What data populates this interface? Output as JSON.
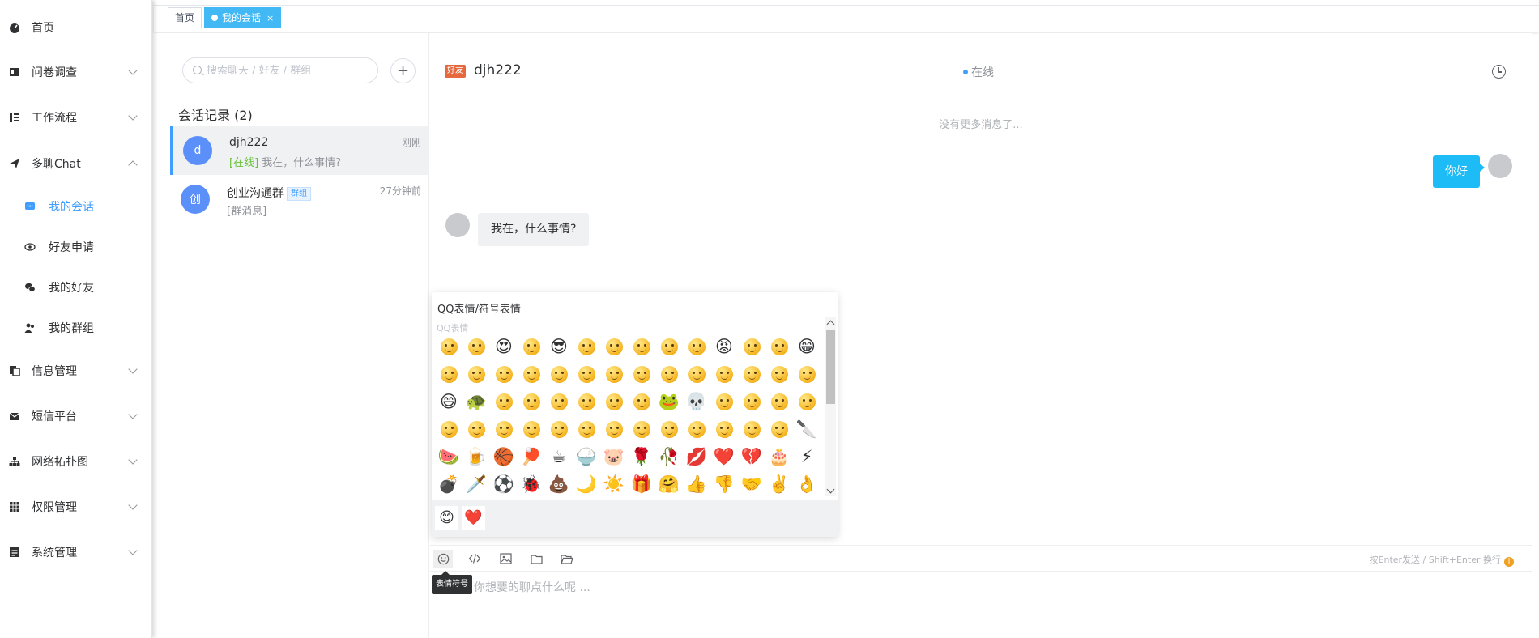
{
  "sidebar": {
    "items": [
      {
        "label": "首页",
        "icon": "dashboard-icon",
        "expandable": false
      },
      {
        "label": "问卷调查",
        "icon": "form-icon",
        "expandable": true
      },
      {
        "label": "工作流程",
        "icon": "list-icon",
        "expandable": true
      },
      {
        "label": "多聊Chat",
        "icon": "send-icon",
        "expandable": true,
        "expanded": true
      },
      {
        "label": "信息管理",
        "icon": "copy-icon",
        "expandable": true
      },
      {
        "label": "短信平台",
        "icon": "mail-icon",
        "expandable": true
      },
      {
        "label": "网络拓扑图",
        "icon": "sitemap-icon",
        "expandable": true
      },
      {
        "label": "权限管理",
        "icon": "grid-icon",
        "expandable": true
      },
      {
        "label": "系统管理",
        "icon": "document-icon",
        "expandable": true
      }
    ],
    "chat_sub": [
      {
        "label": "我的会话",
        "icon": "message-icon",
        "active": true
      },
      {
        "label": "好友申请",
        "icon": "eye-icon",
        "active": false
      },
      {
        "label": "我的好友",
        "icon": "wechat-icon",
        "active": false
      },
      {
        "label": "我的群组",
        "icon": "user-group-icon",
        "active": false
      }
    ]
  },
  "tabs": [
    {
      "label": "首页",
      "active": false
    },
    {
      "label": "我的会话",
      "active": true,
      "close": "×"
    }
  ],
  "conversations": {
    "search_placeholder": "搜索聊天 / 好友 / 群组",
    "add_label": "+",
    "title": "会话记录 (2)",
    "items": [
      {
        "avatar": "d",
        "name": "djh222",
        "time": "刚刚",
        "status": "[在线]",
        "preview": "我在，什么事情?",
        "active": true
      },
      {
        "avatar": "创",
        "name": "创业沟通群",
        "badge": "群组",
        "time": "27分钟前",
        "preview": "[群消息]",
        "active": false
      }
    ]
  },
  "chat": {
    "peer_badge": "好友",
    "peer_name": "djh222",
    "status": "在线",
    "no_more": "没有更多消息了...",
    "messages": [
      {
        "from": "me",
        "text": "你好"
      },
      {
        "from": "peer",
        "text": "我在，什么事情?"
      }
    ]
  },
  "emoji_panel": {
    "title": "QQ表情/符号表情",
    "section": "QQ表情",
    "tabs": [
      "😊",
      "❤️"
    ],
    "rows": [
      [
        "face",
        "face",
        "😍",
        "face",
        "😎",
        "face",
        "face",
        "face",
        "face",
        "face",
        "😡",
        "face",
        "face",
        "😁"
      ],
      [
        "face",
        "face",
        "face",
        "face",
        "face",
        "face",
        "face",
        "face",
        "face",
        "face",
        "face",
        "face",
        "face",
        "face"
      ],
      [
        "😄",
        "🐢",
        "face",
        "face",
        "face",
        "face",
        "face",
        "face",
        "🐸",
        "💀",
        "face",
        "face",
        "face",
        "face"
      ],
      [
        "face",
        "face",
        "face",
        "face",
        "face",
        "face",
        "face",
        "face",
        "face",
        "face",
        "face",
        "face",
        "face",
        "🔪"
      ],
      [
        "🍉",
        "🍺",
        "🏀",
        "🏓",
        "☕",
        "🍚",
        "🐷",
        "🌹",
        "🥀",
        "💋",
        "❤️",
        "💔",
        "🎂",
        "⚡"
      ],
      [
        "💣",
        "🗡️",
        "⚽",
        "🐞",
        "💩",
        "🌙",
        "☀️",
        "🎁",
        "🤗",
        "👍",
        "👎",
        "🤝",
        "✌️",
        "👌"
      ]
    ]
  },
  "toolbar": {
    "tooltip": "表情符号",
    "hint": "按Enter发送 / Shift+Enter 换行",
    "hint_icon": "i",
    "input_placeholder": "你想要的聊点什么呢 ..."
  }
}
